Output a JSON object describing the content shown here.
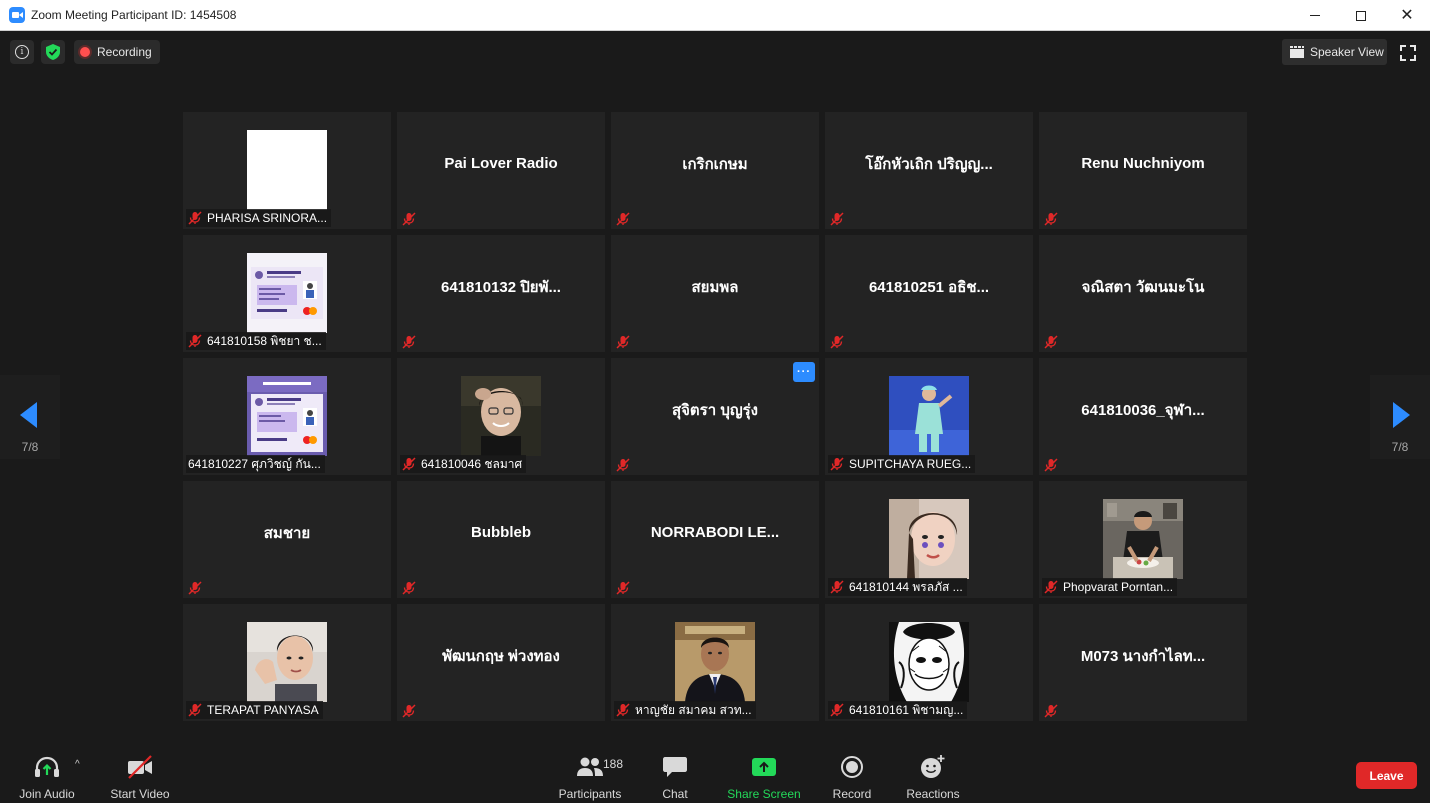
{
  "window": {
    "title": "Zoom Meeting Participant ID: 1454508",
    "controls": {
      "minimize": "",
      "maximize": "",
      "close": "✕"
    }
  },
  "topbar": {
    "info_glyph": "i",
    "recording_label": "Recording",
    "speaker_view_label": "Speaker View"
  },
  "pager": {
    "left_indicator": "7/8",
    "right_indicator": "7/8"
  },
  "colors": {
    "accent_blue": "#2d8cff",
    "muted_red": "#e02828",
    "share_green": "#23d959",
    "recording_red": "#ff4f4f"
  },
  "tiles": [
    {
      "id": "t1",
      "type": "photo",
      "photo": "blank-white",
      "label": "PHARISA SRINORA..."
    },
    {
      "id": "t2",
      "type": "name",
      "center": "Pai Lover Radio"
    },
    {
      "id": "t3",
      "type": "name",
      "center": "เกริกเกษม"
    },
    {
      "id": "t4",
      "type": "name",
      "center": "โอ๊กหัวเถิก ปริญญ..."
    },
    {
      "id": "t5",
      "type": "name",
      "center": "Renu Nuchniyom"
    },
    {
      "id": "t6",
      "type": "photo",
      "photo": "student-card",
      "label": "641810158 พิชยา ช..."
    },
    {
      "id": "t7",
      "type": "name",
      "center": "641810132 ปิยพั..."
    },
    {
      "id": "t8",
      "type": "name",
      "center": "สยมพล"
    },
    {
      "id": "t9",
      "type": "name",
      "center": "641810251 อธิช..."
    },
    {
      "id": "t10",
      "type": "name",
      "center": "จณิสตา วัฒนมะโน"
    },
    {
      "id": "t11",
      "type": "photo",
      "photo": "student-card-info",
      "label": "641810227 ศุภวิชญ์ กัน...",
      "muted": false
    },
    {
      "id": "t12",
      "type": "photo",
      "photo": "person-smiling",
      "label": "641810046 ชลมาศ"
    },
    {
      "id": "t13",
      "type": "name",
      "center": "สุจิตรา บุญรุ่ง",
      "more": "···"
    },
    {
      "id": "t14",
      "type": "photo",
      "photo": "person-blue-bg",
      "label": "SUPITCHAYA RUEG..."
    },
    {
      "id": "t15",
      "type": "name",
      "center": "641810036_จุฬา..."
    },
    {
      "id": "t16",
      "type": "name",
      "center": "สมชาย"
    },
    {
      "id": "t17",
      "type": "name",
      "center": "Bubbleb"
    },
    {
      "id": "t18",
      "type": "name",
      "center": "NORRABODI LE..."
    },
    {
      "id": "t19",
      "type": "photo",
      "photo": "person-selfie",
      "label": "641810144 พรลภัส ..."
    },
    {
      "id": "t20",
      "type": "photo",
      "photo": "person-cooking",
      "label": "Phopvarat Porntan..."
    },
    {
      "id": "t21",
      "type": "photo",
      "photo": "person-waving",
      "label": "TERAPAT PANYASA"
    },
    {
      "id": "t22",
      "type": "name",
      "center": "พัฒนกฤษ พ่วงทอง"
    },
    {
      "id": "t23",
      "type": "photo",
      "photo": "person-suit",
      "label": "หาญชัย สมาคม สวท..."
    },
    {
      "id": "t24",
      "type": "photo",
      "photo": "manga-art",
      "label": "641810161 พิชามญ..."
    },
    {
      "id": "t25",
      "type": "name",
      "center": "M073 นางกำไลท..."
    }
  ],
  "toolbar": {
    "join_audio": "Join Audio",
    "start_video": "Start Video",
    "participants": "Participants",
    "participants_count": "188",
    "chat": "Chat",
    "share_screen": "Share Screen",
    "record": "Record",
    "reactions": "Reactions",
    "leave": "Leave",
    "caret": "^"
  },
  "icons": {
    "app": "zoom-logo-icon",
    "info": "info-icon",
    "shield": "shield-check-icon",
    "speaker_view": "speaker-view-icon",
    "fullscreen": "fullscreen-icon",
    "mic": "mic-muted-icon",
    "join_audio": "headphone-icon",
    "start_video": "video-off-icon",
    "participants": "people-icon",
    "chat": "chat-bubble-icon",
    "share": "share-screen-icon",
    "record": "record-icon",
    "reactions": "emoji-plus-icon"
  }
}
